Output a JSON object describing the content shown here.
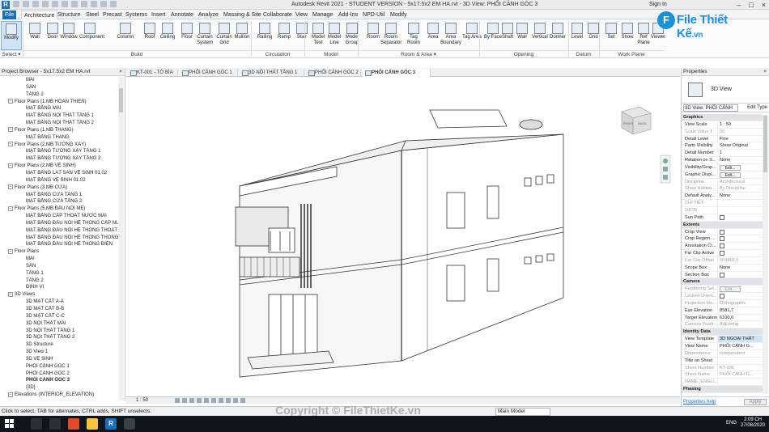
{
  "window": {
    "app_icon": "R",
    "title": "Autodesk Revit 2021 - STUDENT VERSION - 5x17.5x2 EM HA.rvt - 3D View: PHỐI CẢNH GÓC 3",
    "sign_in": "Sign In"
  },
  "ribbon_tabs": [
    "File",
    "Architecture",
    "Structure",
    "Steel",
    "Precast",
    "Systems",
    "Insert",
    "Annotate",
    "Analyze",
    "Massing & Site",
    "Collaborate",
    "View",
    "Manage",
    "Add-Ins",
    "NPD-Util",
    "Modify"
  ],
  "ribbon": {
    "buttons": [
      "Modify",
      "Wall",
      "Door",
      "Window",
      "Component",
      "Column",
      "Roof",
      "Ceiling",
      "Floor",
      "Curtain System",
      "Curtain Grid",
      "Mullion",
      "Railing",
      "Ramp",
      "Stair",
      "Model Text",
      "Model Line",
      "Model Group",
      "Room",
      "Room Separator",
      "Tag Room",
      "Area",
      "Area Boundary",
      "Tag Area",
      "By Face",
      "Shaft",
      "Wall",
      "Vertical",
      "Dormer",
      "Level",
      "Grid",
      "Set",
      "Show",
      "Ref Plane",
      "Viewer"
    ],
    "groups": [
      "Select ▾",
      "Build",
      "Circulation",
      "Model",
      "Room & Area ▾",
      "Opening",
      "Datum",
      "Work Plane"
    ]
  },
  "logo": {
    "mark": "F",
    "text": "File Thiết Kế",
    "suffix": ".vn"
  },
  "browser": {
    "title": "Project Browser - 5x17.5x2 EM HA.rvt",
    "items": [
      {
        "t": "MÁI",
        "l": 3
      },
      {
        "t": "SÂN",
        "l": 3
      },
      {
        "t": "TẦNG 2",
        "l": 3
      },
      {
        "t": "Floor Plans (1.MB HOÀN THIỆN)",
        "l": 2,
        "g": true
      },
      {
        "t": "MẶT BẰNG MÁI",
        "l": 3
      },
      {
        "t": "MẶT BẰNG NỘI THẤT TẦNG 1",
        "l": 3
      },
      {
        "t": "MẶT BẰNG NỘI THẤT TẦNG 2",
        "l": 3
      },
      {
        "t": "Floor Plans (1.MB THANG)",
        "l": 2,
        "g": true
      },
      {
        "t": "MẶT BẰNG THANG",
        "l": 3
      },
      {
        "t": "Floor Plans (2.MB TƯỜNG XÂY)",
        "l": 2,
        "g": true
      },
      {
        "t": "MẶT BẰNG TƯỜNG XÂY TẦNG 1",
        "l": 3
      },
      {
        "t": "MẶT BẰNG TƯỜNG XÂY TẦNG 2",
        "l": 3
      },
      {
        "t": "Floor Plans (2.MB VỆ SINH)",
        "l": 2,
        "g": true
      },
      {
        "t": "MẶT BẰNG LÁT SÀN VỆ SINH 01.02",
        "l": 3
      },
      {
        "t": "MẶT BẰNG VỆ SINH 01.02",
        "l": 3
      },
      {
        "t": "Floor Plans (3.MB CỬA)",
        "l": 2,
        "g": true
      },
      {
        "t": "MẶT BẰNG CỬA TẦNG 1",
        "l": 3
      },
      {
        "t": "MẶT BẰNG CỬA TẦNG 2",
        "l": 3
      },
      {
        "t": "Floor Plans (5.MB ĐẤU NỐI ME)",
        "l": 2,
        "g": true
      },
      {
        "t": "MẶT BẰNG CẤP THOÁT NƯỚC MÁI",
        "l": 3
      },
      {
        "t": "MẶT BẰNG ĐẤU NỐI HỆ THỐNG CẤP NƯỚC",
        "l": 3
      },
      {
        "t": "MẶT BẰNG ĐẤU NỐI HỆ THỐNG THOÁT N",
        "l": 3
      },
      {
        "t": "MẶT BẰNG ĐẤU NỐI HỆ THỐNG THÔNG T",
        "l": 3
      },
      {
        "t": "MẶT BẰNG ĐẤU NỐI HỆ THỐNG ĐIỆN",
        "l": 3
      },
      {
        "t": "Floor Plans",
        "l": 2,
        "g": true
      },
      {
        "t": "MÁI",
        "l": 3
      },
      {
        "t": "SÂN",
        "l": 3
      },
      {
        "t": "TẦNG 1",
        "l": 3
      },
      {
        "t": "TẦNG 2",
        "l": 3
      },
      {
        "t": "ĐỊNH VỊ",
        "l": 3
      },
      {
        "t": "3D Views",
        "l": 2,
        "g": true
      },
      {
        "t": "3D MẶT CẮT A-A",
        "l": 3
      },
      {
        "t": "3D MẶT CẮT B-B",
        "l": 3
      },
      {
        "t": "3D MẶT CẮT C-C",
        "l": 3
      },
      {
        "t": "3D NỘI THẤT MÁI",
        "l": 3
      },
      {
        "t": "3D NỘI THẤT TẦNG 1",
        "l": 3
      },
      {
        "t": "3D NỘI THẤT TẦNG 2",
        "l": 3
      },
      {
        "t": "3D Structure",
        "l": 3
      },
      {
        "t": "3D View 1",
        "l": 3
      },
      {
        "t": "3D VỆ SINH",
        "l": 3
      },
      {
        "t": "PHỐI CẢNH GÓC 1",
        "l": 3
      },
      {
        "t": "PHỐI CẢNH GÓC 2",
        "l": 3
      },
      {
        "t": "PHỐI CẢNH GÓC 3",
        "l": 3,
        "b": true
      },
      {
        "t": "{3D}",
        "l": 3
      },
      {
        "t": "Elevations (INTERIOR_ELEVATION)",
        "l": 2,
        "g": true
      }
    ]
  },
  "view_tabs": [
    {
      "label": "KT-001 - TỜ BÌA",
      "active": false
    },
    {
      "label": "PHỐI CẢNH GÓC 1",
      "active": false
    },
    {
      "label": "3D NỘI THẤT TẦNG 1",
      "active": false
    },
    {
      "label": "PHỐI CẢNH GÓC 2",
      "active": false
    },
    {
      "label": "PHỐI CẢNH GÓC 3",
      "active": true
    }
  ],
  "view_control": {
    "scale": "1 : 50"
  },
  "viewcube": {
    "face1": "RIGHT",
    "face2": "BACK"
  },
  "properties": {
    "title": "Properties",
    "type_name": "3D View",
    "selector": "3D View: PHỐI CẢNH",
    "edit_type": "Edit Type",
    "rows": [
      {
        "cat": "Graphics"
      },
      {
        "k": "View Scale",
        "v": "1 : 50"
      },
      {
        "k": "Scale Value 1:",
        "v": "50",
        "grey": true
      },
      {
        "k": "Detail Level",
        "v": "Fine"
      },
      {
        "k": "Parts Visibility",
        "v": "Show Original"
      },
      {
        "k": "Detail Number",
        "v": "1"
      },
      {
        "k": "Rotation on S...",
        "v": "None"
      },
      {
        "k": "Visibility/Grap...",
        "btn": "Edit..."
      },
      {
        "k": "Graphic Displ...",
        "btn": "Edit..."
      },
      {
        "k": "Discipline",
        "v": "Architectural",
        "grey": true
      },
      {
        "k": "Show Hidden ...",
        "v": "By Discipline",
        "grey": true
      },
      {
        "k": "Default Analy...",
        "v": "None"
      },
      {
        "k": "CHI TIẾT",
        "v": "",
        "grey": true
      },
      {
        "k": "GDTK",
        "v": "",
        "grey": true
      },
      {
        "k": "Sun Path",
        "cb": true
      },
      {
        "cat": "Extents"
      },
      {
        "k": "Crop View",
        "cb": true
      },
      {
        "k": "Crop Region ...",
        "cb": true
      },
      {
        "k": "Annotation Cr...",
        "cb": true
      },
      {
        "k": "Far Clip Active",
        "cb": true
      },
      {
        "k": "Far Clip Offset",
        "v": "304800,0",
        "grey": true
      },
      {
        "k": "Scope Box",
        "v": "None"
      },
      {
        "k": "Section Box",
        "cb": true
      },
      {
        "cat": "Camera"
      },
      {
        "k": "Rendering Set...",
        "btn": "Edit...",
        "grey": true
      },
      {
        "k": "Locked Orient...",
        "cb": true,
        "grey": true
      },
      {
        "k": "Projection Mo...",
        "v": "Orthographic",
        "grey": true
      },
      {
        "k": "Eye Elevation",
        "v": "8581,7"
      },
      {
        "k": "Target Elevation",
        "v": "6100,0"
      },
      {
        "k": "Camera Positi...",
        "v": "Adjusting",
        "grey": true
      },
      {
        "cat": "Identity Data"
      },
      {
        "k": "View Template",
        "v": "3D NGOẠI THẤT",
        "hl": true
      },
      {
        "k": "View Name",
        "v": "PHỐI CẢNH G..."
      },
      {
        "k": "Dependency",
        "v": "Independent",
        "grey": true
      },
      {
        "k": "Title on Sheet",
        "v": ""
      },
      {
        "k": "Sheet Number",
        "v": "KT-006",
        "grey": true
      },
      {
        "k": "Sheet Name",
        "v": "PHỐI CẢNH G...",
        "grey": true
      },
      {
        "k": "NAME_ENGLI...",
        "v": "",
        "grey": true
      },
      {
        "cat": "Phasing"
      }
    ],
    "help": "Properties help",
    "apply": "Apply"
  },
  "status": {
    "message": "Click to select, TAB for alternates, CTRL adds, SHIFT unselects.",
    "model": "Main Model"
  },
  "taskbar": {
    "lang": "ENG",
    "time": "2:09 CH",
    "date": "27/08/2020"
  },
  "watermark": "Copyright © FileThietKe.vn",
  "colors": {
    "accent": "#1a6fb6",
    "logo": "#1e90d6",
    "taskbar": "#10151c"
  }
}
